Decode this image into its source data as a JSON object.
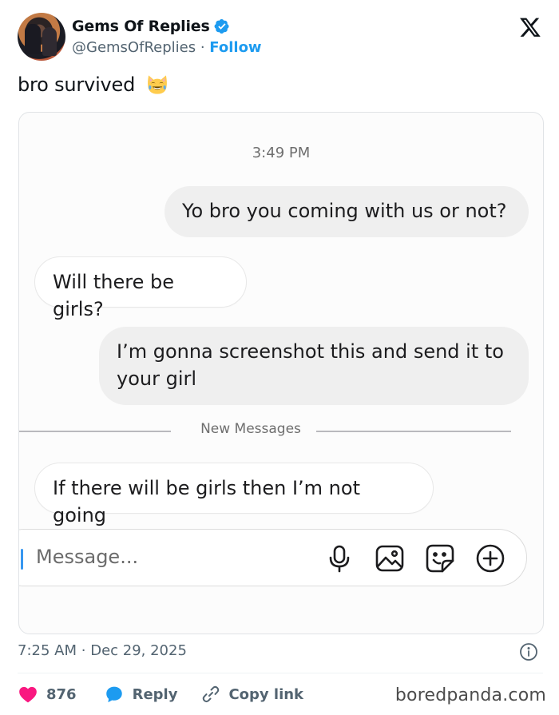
{
  "author": {
    "display_name": "Gems Of Replies",
    "handle": "@GemsOfReplies",
    "separator": "·",
    "follow_label": "Follow"
  },
  "tweet": {
    "text": "bro survived"
  },
  "media": {
    "timestamp": "3:49 PM",
    "messages": [
      {
        "direction": "sent",
        "text": "Yo bro you coming with us or not?"
      },
      {
        "direction": "received",
        "text": "Will there be girls?"
      },
      {
        "direction": "sent",
        "line1": "I’m gonna screenshot this and send it to",
        "line2": "your girl"
      },
      {
        "direction": "received",
        "text": "If there will be girls then I’m not going"
      }
    ],
    "divider_label": "New Messages",
    "composer": {
      "placeholder": "Message...",
      "icons": [
        "microphone-icon",
        "image-icon",
        "sticker-icon",
        "add-icon"
      ]
    }
  },
  "footer": {
    "time": "7:25 AM",
    "separator": "·",
    "date": "Dec 29, 2025",
    "like_count": "876",
    "reply_label": "Reply",
    "copy_label": "Copy link",
    "watermark": "boredpanda.com"
  },
  "colors": {
    "accent": "#1d9bf0",
    "like": "#f91880",
    "text_secondary": "#536471",
    "sent_bubble": "#efefef"
  }
}
